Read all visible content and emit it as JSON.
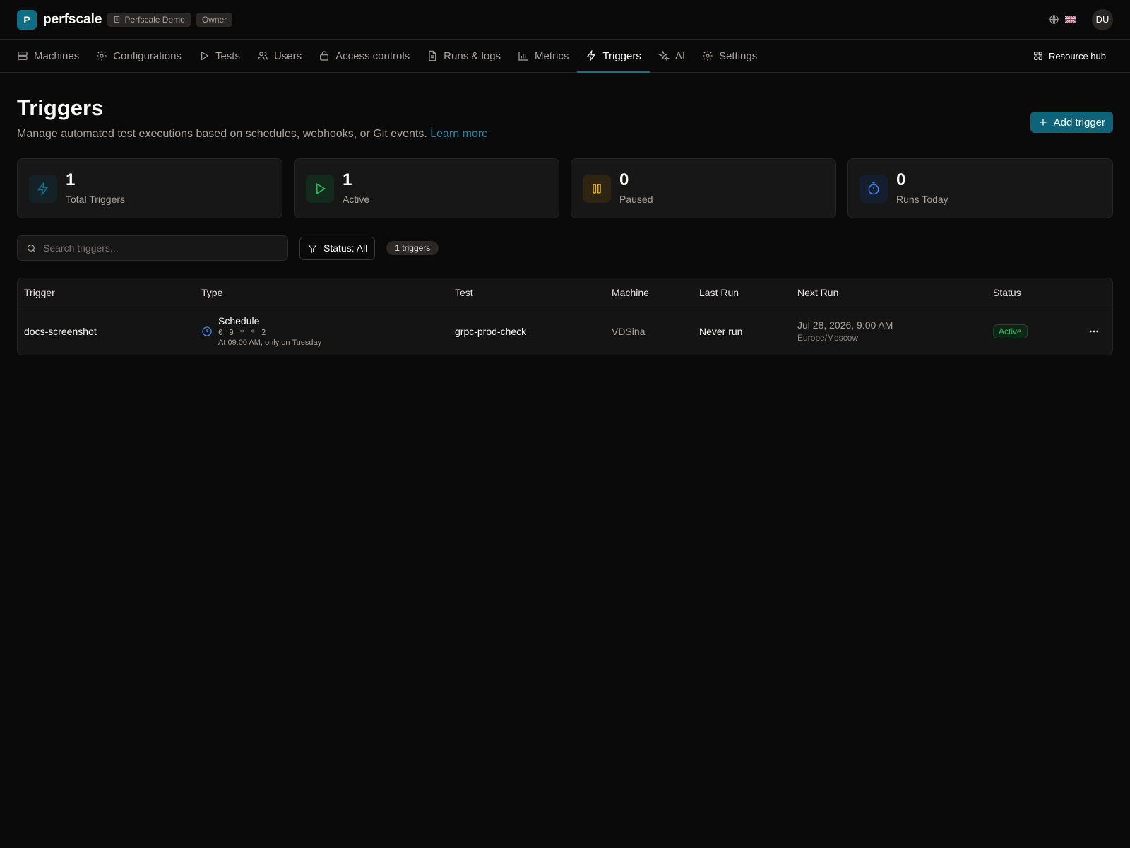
{
  "header": {
    "logo_letter": "P",
    "brand": "perfscale",
    "org": "Perfscale Demo",
    "role": "Owner",
    "avatar": "DU"
  },
  "nav": {
    "items": [
      {
        "label": "Machines",
        "icon": "server-icon"
      },
      {
        "label": "Configurations",
        "icon": "gear-icon"
      },
      {
        "label": "Tests",
        "icon": "play-icon"
      },
      {
        "label": "Users",
        "icon": "users-icon"
      },
      {
        "label": "Access controls",
        "icon": "lock-icon"
      },
      {
        "label": "Runs & logs",
        "icon": "document-icon"
      },
      {
        "label": "Metrics",
        "icon": "bar-chart-icon"
      },
      {
        "label": "Triggers",
        "icon": "lightning-icon",
        "active": true
      },
      {
        "label": "AI",
        "icon": "sparkles-icon"
      },
      {
        "label": "Settings",
        "icon": "gear-icon"
      }
    ],
    "resource_hub": "Resource hub"
  },
  "page": {
    "title": "Triggers",
    "subtitle": "Manage automated test executions based on schedules, webhooks, or Git events.",
    "learn_more": "Learn more",
    "add_button": "Add trigger"
  },
  "stats": [
    {
      "value": "1",
      "label": "Total Triggers",
      "color": "#0e7490"
    },
    {
      "value": "1",
      "label": "Active",
      "color": "#22c55e"
    },
    {
      "value": "0",
      "label": "Paused",
      "color": "#eab308"
    },
    {
      "value": "0",
      "label": "Runs Today",
      "color": "#3b82f6"
    }
  ],
  "toolbar": {
    "search_placeholder": "Search triggers...",
    "filter_label": "Status: All",
    "count": "1 triggers"
  },
  "table": {
    "columns": [
      "Trigger",
      "Type",
      "Test",
      "Machine",
      "Last Run",
      "Next Run",
      "Status"
    ],
    "rows": [
      {
        "trigger": "docs-screenshot",
        "type": "Schedule",
        "cron": "0 9 * * 2",
        "cron_desc": "At 09:00 AM, only on Tuesday",
        "test": "grpc-prod-check",
        "machine": "VDSina",
        "last_run": "Never run",
        "next_run": "Jul 28, 2026, 9:00 AM",
        "timezone": "Europe/Moscow",
        "status": "Active"
      }
    ]
  },
  "colors": {
    "accent": "#0e7490",
    "background": "#0b0a0a",
    "active_status": "#22c55e"
  }
}
